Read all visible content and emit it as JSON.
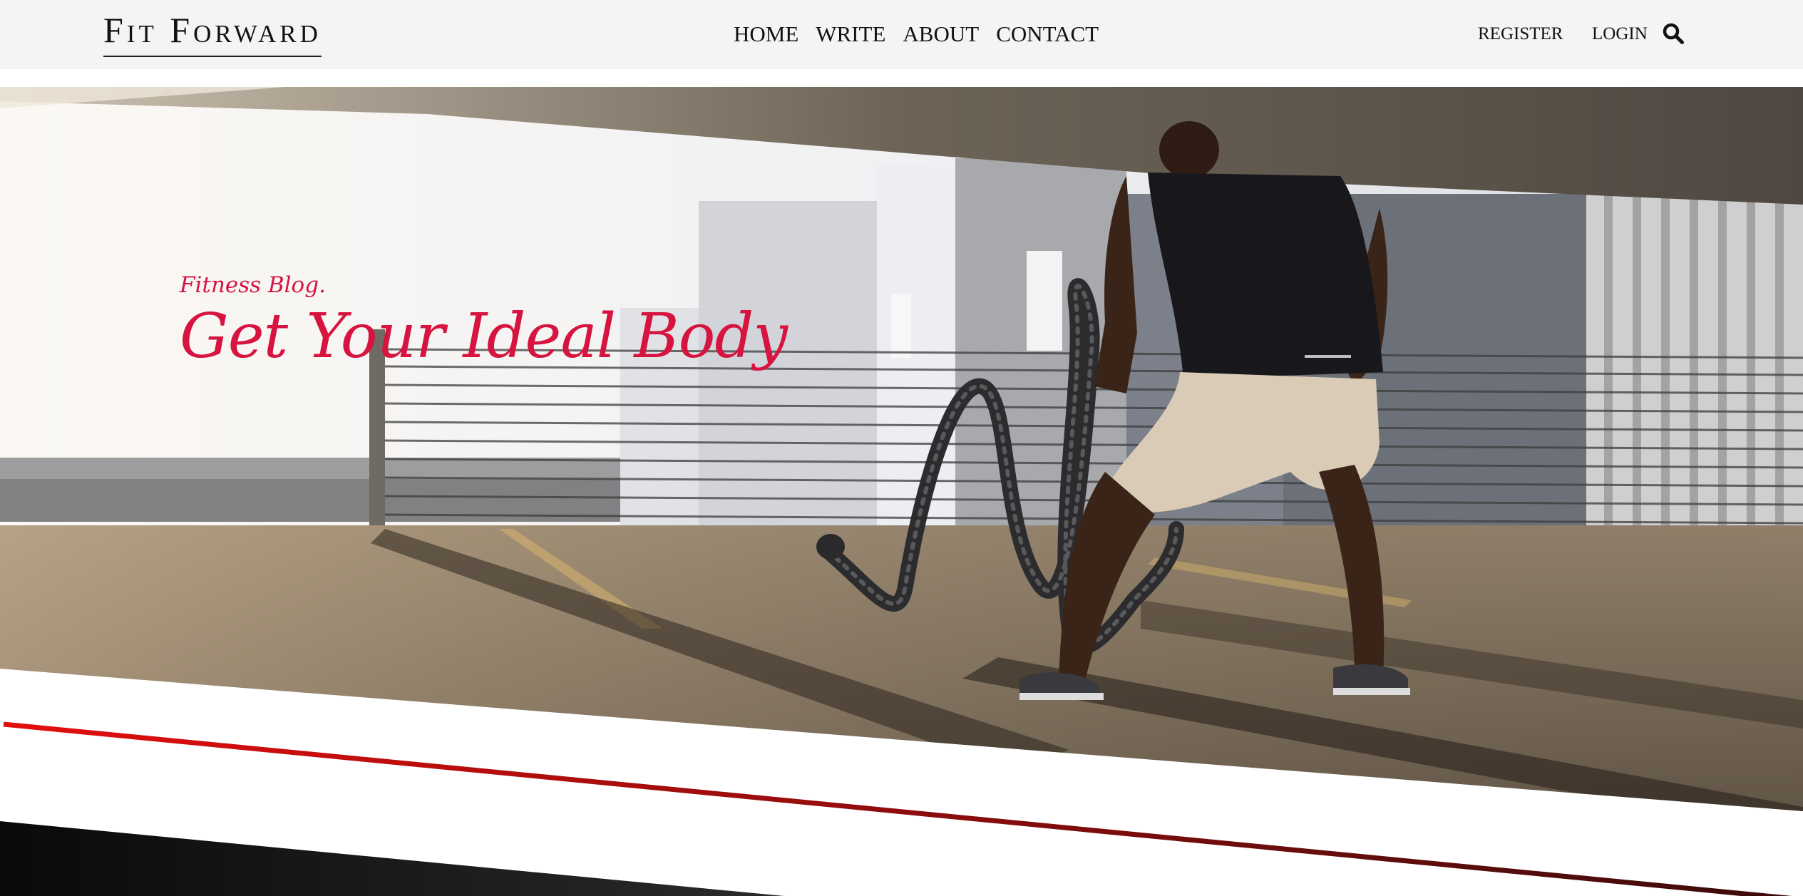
{
  "header": {
    "logo": "Fit Forward",
    "nav": [
      "HOME",
      "WRITE",
      "ABOUT",
      "CONTACT"
    ],
    "register": "REGISTER",
    "login": "LOGIN",
    "search_icon": "search-icon"
  },
  "hero": {
    "subtitle": "Fitness Blog.",
    "title": "Get Your Ideal Body",
    "accent_color": "#d6143f",
    "divider_color": "#e30e0e"
  }
}
